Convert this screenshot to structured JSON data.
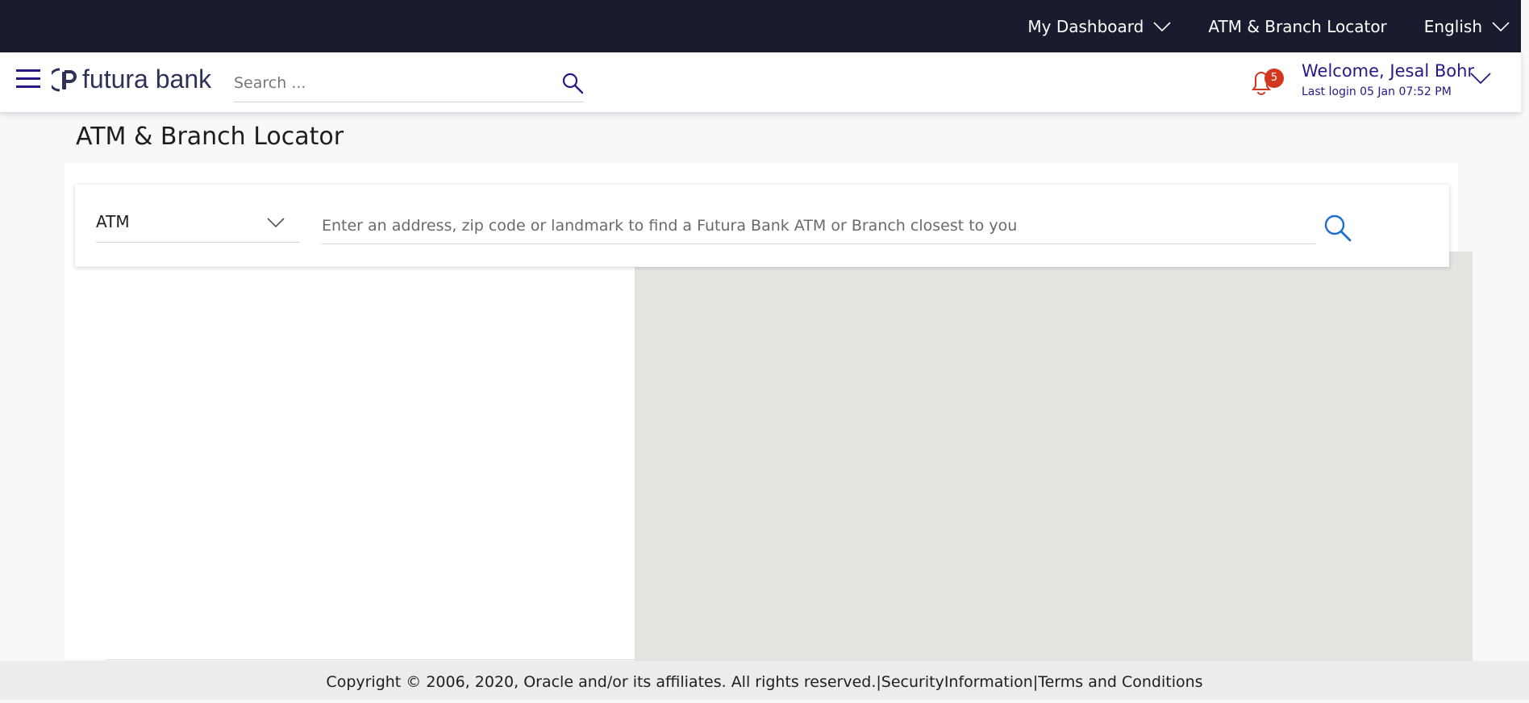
{
  "topbar": {
    "dashboard_label": "My Dashboard",
    "locator_label": "ATM & Branch Locator",
    "language_label": "English"
  },
  "header": {
    "brand_name": "futura bank",
    "search_placeholder": "Search ...",
    "notification_count": "5",
    "welcome_text": "Welcome, Jesal Bohr",
    "last_login": "Last login 05 Jan 07:52 PM"
  },
  "page": {
    "title": "ATM & Branch Locator"
  },
  "locator": {
    "type_value": "ATM",
    "address_placeholder": "Enter an address, zip code or landmark to find a Futura Bank ATM or Branch closest to you"
  },
  "footer": {
    "copyright": "Copyright © 2006, 2020, Oracle and/or its affiliates. All rights reserved.",
    "separator": "|",
    "security_link": "SecurityInformation",
    "terms_link": "Terms and Conditions"
  },
  "colors": {
    "topbar_bg": "#181c2e",
    "accent_purple": "#2a1787",
    "search_icon_blue": "#1b6fd0",
    "badge_red": "#d1361f",
    "map_bg": "#e5e3df"
  },
  "icons": {
    "menu": "hamburger-menu-icon",
    "search": "search-icon",
    "notifications": "bell-icon",
    "dropdown": "chevron-down-icon"
  }
}
